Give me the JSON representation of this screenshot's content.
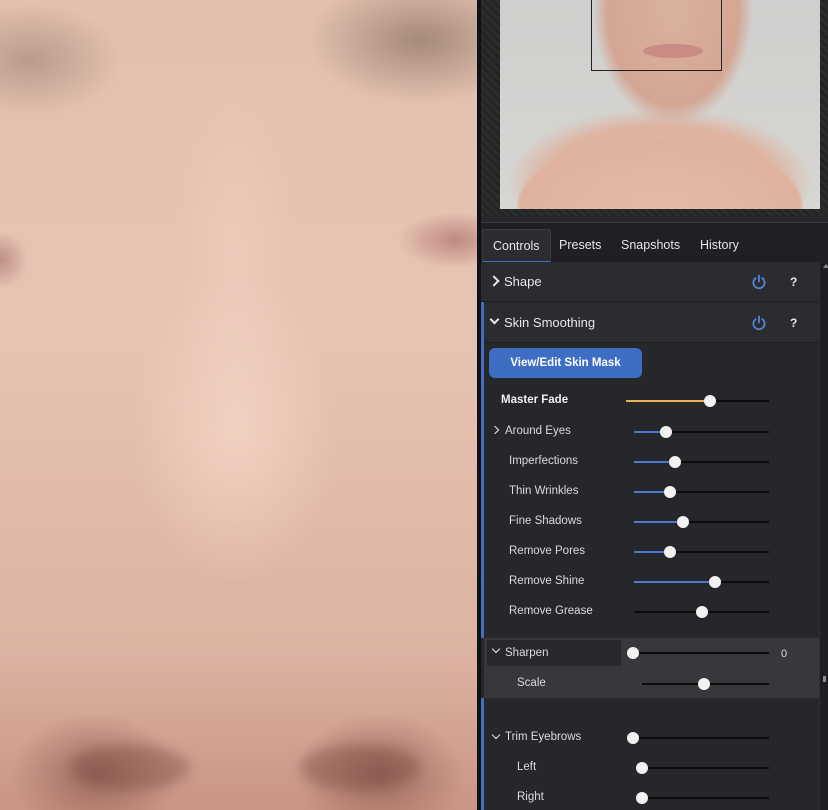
{
  "tabs": [
    {
      "label": "Controls",
      "active": true
    },
    {
      "label": "Presets",
      "active": false
    },
    {
      "label": "Snapshots",
      "active": false
    },
    {
      "label": "History",
      "active": false
    }
  ],
  "sections": {
    "shape": {
      "label": "Shape",
      "help": "?"
    },
    "skin_smoothing": {
      "label": "Skin Smoothing",
      "help": "?"
    }
  },
  "mask_button": {
    "label": "View/Edit Skin Mask"
  },
  "master_fade": {
    "label": "Master Fade",
    "value_fraction": 0.59
  },
  "skin_sliders": [
    {
      "label": "Around Eyes",
      "value_fraction": 0.24
    },
    {
      "label": "Imperfections",
      "value_fraction": 0.3
    },
    {
      "label": "Thin Wrinkles",
      "value_fraction": 0.27
    },
    {
      "label": "Fine Shadows",
      "value_fraction": 0.36
    },
    {
      "label": "Remove Pores",
      "value_fraction": 0.27
    },
    {
      "label": "Remove Shine",
      "value_fraction": 0.6
    },
    {
      "label": "Remove Grease",
      "value_fraction": 0.5
    }
  ],
  "sharpen": {
    "label": "Sharpen",
    "value": "0",
    "value_fraction": 0.0
  },
  "scale": {
    "label": "Scale",
    "value_fraction": 0.49
  },
  "trim_eyebrows": {
    "label": "Trim Eyebrows",
    "value_fraction": 0.0
  },
  "left": {
    "label": "Left",
    "value_fraction": 0.0
  },
  "right": {
    "label": "Right",
    "value_fraction": 0.0
  },
  "colors": {
    "accent": "#3f6fc2",
    "master_fill": "#e7b35a"
  }
}
